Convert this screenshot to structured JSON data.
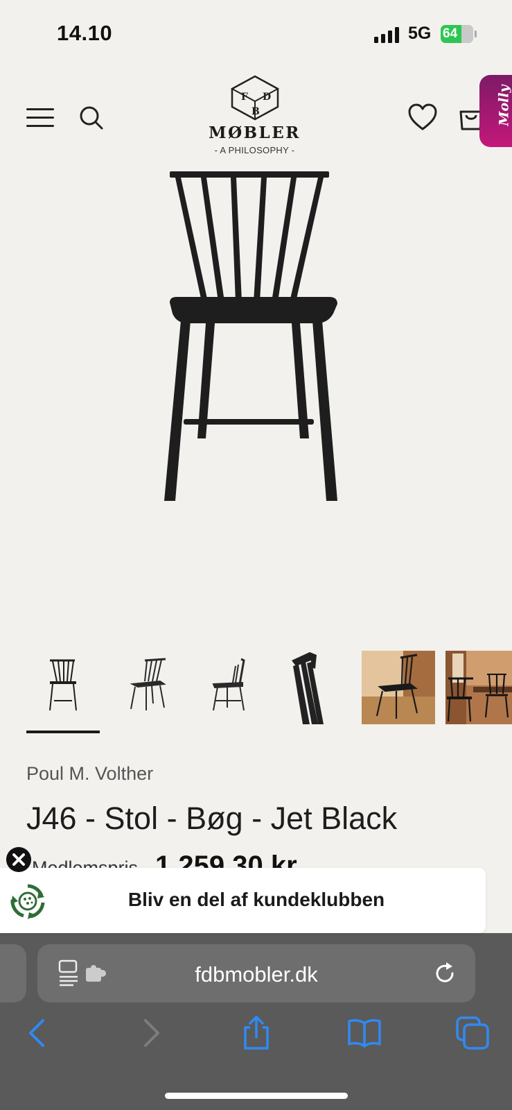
{
  "status_bar": {
    "time": "14.10",
    "network": "5G",
    "battery_percent": "64"
  },
  "header": {
    "logo": {
      "name": "MØBLER",
      "tagline": "- A PHILOSOPHY -",
      "mark_letters": [
        "F",
        "D",
        "B"
      ]
    },
    "icons": [
      "menu-icon",
      "search-icon",
      "heart-icon",
      "bag-icon"
    ],
    "chat_widget_label": "Molly"
  },
  "product": {
    "designer": "Poul M. Volther",
    "title": "J46 - Stol - Bøg - Jet Black",
    "price_label": "Medlemspris",
    "price": "1.259,30 kr.",
    "thumbnails": [
      {
        "label": "front view",
        "selected": true
      },
      {
        "label": "angled view",
        "selected": false
      },
      {
        "label": "side view",
        "selected": false
      },
      {
        "label": "detail view",
        "selected": false
      },
      {
        "label": "room photo",
        "selected": false
      },
      {
        "label": "dining photo",
        "selected": false
      }
    ]
  },
  "popup": {
    "text": "Bliv en del af kundeklubben"
  },
  "browser": {
    "url": "fdbmobler.dk",
    "nav": [
      "back-icon",
      "forward-icon",
      "share-icon",
      "bookmarks-icon",
      "tabs-icon"
    ]
  },
  "colors": {
    "page_bg": "#f2f1ed",
    "battery": "#2dc653",
    "molly_gradient_top": "#7d1a67",
    "molly_gradient_bottom": "#c4187a",
    "browser_chrome": "#5a5a5a",
    "ios_blue": "#2f8af5"
  }
}
